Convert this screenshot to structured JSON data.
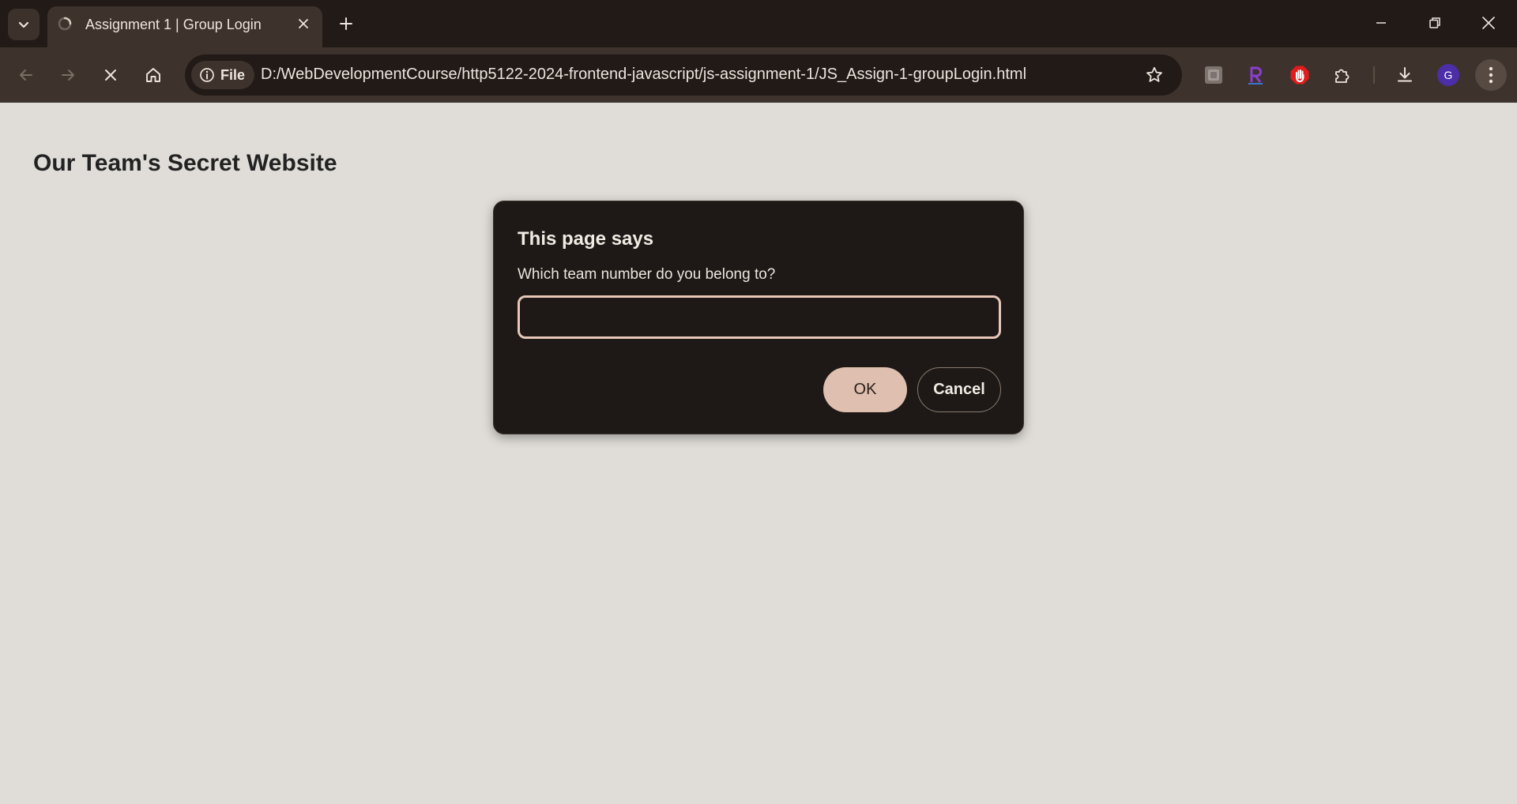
{
  "browser": {
    "tab": {
      "title": "Assignment 1 | Group Login"
    },
    "omnibox": {
      "scheme_label": "File",
      "url": "D:/WebDevelopmentCourse/http5122-2024-frontend-javascript/js-assignment-1/JS_Assign-1-groupLogin.html"
    },
    "profile_initial": "G",
    "extensions": [
      "screen-capture-icon",
      "r-extension-icon",
      "adblock-hand-icon",
      "extensions-puzzle-icon"
    ],
    "colors": {
      "tabstrip_bg": "#211a17",
      "toolbar_bg": "#3e332c",
      "omnibox_bg": "#211a17",
      "avatar_bg": "#4b2ea8"
    }
  },
  "page": {
    "heading": "Our Team's Secret Website",
    "background": "#e0ddd8"
  },
  "dialog": {
    "title": "This page says",
    "message": "Which team number do you belong to?",
    "input_value": "",
    "ok_label": "OK",
    "cancel_label": "Cancel",
    "colors": {
      "bg": "#1e1916",
      "input_border": "#e6c7b8",
      "ok_bg": "#dfbfaf"
    }
  }
}
